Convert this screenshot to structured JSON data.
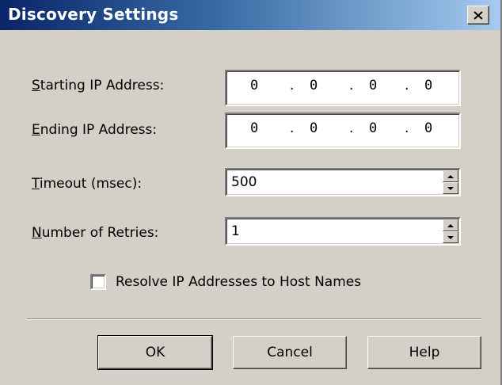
{
  "window": {
    "title": "Discovery Settings",
    "close_icon": "close-icon"
  },
  "fields": {
    "starting_ip": {
      "label_mnemonic": "S",
      "label_rest": "tarting IP Address:",
      "octets": [
        "0",
        "0",
        "0",
        "0"
      ]
    },
    "ending_ip": {
      "label_mnemonic": "E",
      "label_rest": "nding IP Address:",
      "octets": [
        "0",
        "0",
        "0",
        "0"
      ]
    },
    "timeout": {
      "label_mnemonic": "T",
      "label_rest": "imeout (msec):",
      "value": "500"
    },
    "retries": {
      "label_mnemonic": "N",
      "label_rest": "umber of Retries:",
      "value": "1"
    }
  },
  "resolve_checkbox": {
    "label": "Resolve IP Addresses to Host Names",
    "checked": false
  },
  "buttons": {
    "ok": "OK",
    "cancel": "Cancel",
    "help": "Help"
  },
  "colors": {
    "title_start": "#0a246a",
    "title_end": "#a6caf0",
    "face": "#d4d0c8"
  }
}
